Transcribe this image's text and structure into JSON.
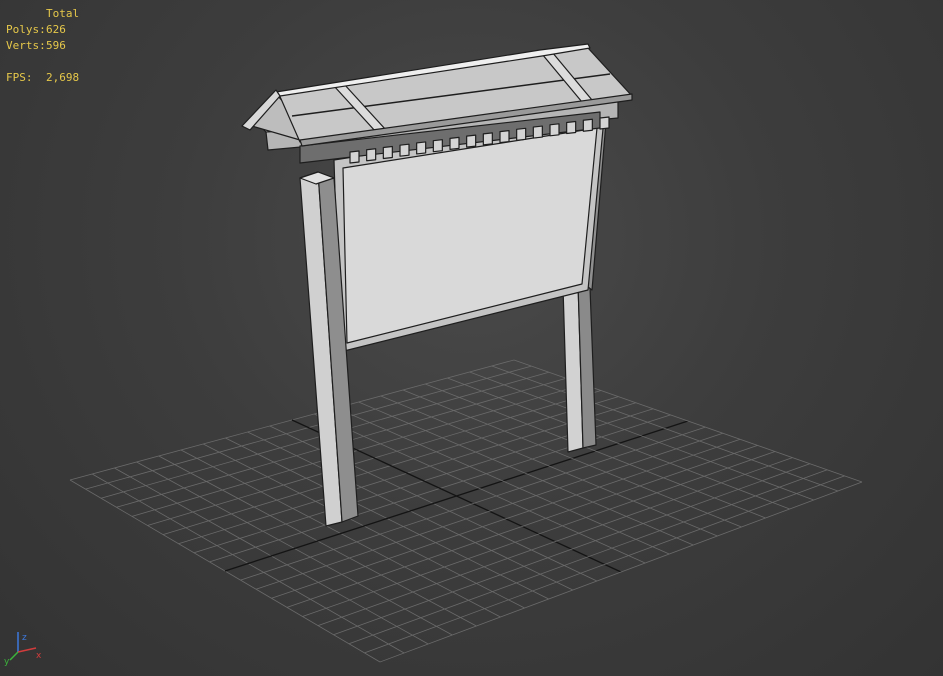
{
  "stats": {
    "header": "Total",
    "polys_label": "Polys:",
    "polys_value": "626",
    "verts_label": "Verts:",
    "verts_value": "596",
    "fps_label": "FPS:",
    "fps_value": "2,698"
  },
  "colors": {
    "background": "#3d3d3d",
    "stats_text": "#e6c84a",
    "grid": "#6a6a6a",
    "grid_axis": "#141414",
    "model_light": "#cfcfcf",
    "model_mid": "#a9a9a9",
    "model_dark": "#7d7d7d",
    "edge": "#1e1e1e",
    "axis_x": "#d23c3c",
    "axis_y": "#3cb43c",
    "axis_z": "#3c78dc"
  },
  "gizmo": {
    "axes": [
      "x",
      "y",
      "z"
    ]
  }
}
